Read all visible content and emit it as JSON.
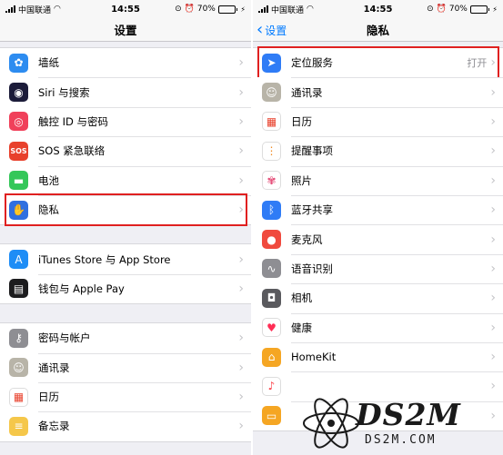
{
  "left": {
    "status": {
      "carrier": "中国联通",
      "time": "14:55",
      "battery": "70%",
      "battery_fill": 0.7
    },
    "nav_title": "设置",
    "groups": [
      [
        {
          "label": "墙纸",
          "icon": "wallpaper-icon",
          "color": "#2d8cf0"
        },
        {
          "label": "Siri 与搜索",
          "icon": "siri-icon",
          "color": "#1c1c3a"
        },
        {
          "label": "触控 ID 与密码",
          "icon": "fingerprint-icon",
          "color": "#f0405a"
        },
        {
          "label": "SOS 紧急联络",
          "icon": "sos-icon",
          "color": "#e8412c",
          "icon_text": "SOS"
        },
        {
          "label": "电池",
          "icon": "battery-icon",
          "color": "#34c759"
        },
        {
          "label": "隐私",
          "icon": "hand-icon",
          "color": "#2f6fe0",
          "highlighted": true
        }
      ],
      [
        {
          "label": "iTunes Store 与 App Store",
          "icon": "app-store-icon",
          "color": "#1e8df6"
        },
        {
          "label": "钱包与 Apple Pay",
          "icon": "wallet-icon",
          "color": "#1c1c1e"
        }
      ],
      [
        {
          "label": "密码与帐户",
          "icon": "key-icon",
          "color": "#8e8e93"
        },
        {
          "label": "通讯录",
          "icon": "contacts-icon",
          "color": "#b8b4a8"
        },
        {
          "label": "日历",
          "icon": "calendar-icon",
          "color": "#ffffff"
        },
        {
          "label": "备忘录",
          "icon": "notes-icon",
          "color": "#f5c74a"
        }
      ]
    ]
  },
  "right": {
    "status": {
      "carrier": "中国联通",
      "time": "14:55",
      "battery": "70%",
      "battery_fill": 0.7
    },
    "nav_back": "设置",
    "nav_title": "隐私",
    "groups": [
      [
        {
          "label": "定位服务",
          "icon": "location-arrow-icon",
          "color": "#2f7cf6",
          "value": "打开",
          "highlighted": true
        },
        {
          "label": "通讯录",
          "icon": "contacts-icon",
          "color": "#b8b4a8"
        },
        {
          "label": "日历",
          "icon": "calendar-icon",
          "color": "#ffffff"
        },
        {
          "label": "提醒事项",
          "icon": "reminders-icon",
          "color": "#ffffff"
        },
        {
          "label": "照片",
          "icon": "photos-icon",
          "color": "#ffffff"
        },
        {
          "label": "蓝牙共享",
          "icon": "bluetooth-icon",
          "color": "#2f7cf6"
        },
        {
          "label": "麦克风",
          "icon": "microphone-icon",
          "color": "#f04a3e"
        },
        {
          "label": "语音识别",
          "icon": "waveform-icon",
          "color": "#8e8e93"
        },
        {
          "label": "相机",
          "icon": "camera-icon",
          "color": "#5a5a5e"
        },
        {
          "label": "健康",
          "icon": "heart-icon",
          "color": "#ffffff"
        },
        {
          "label": "HomeKit",
          "icon": "home-icon",
          "color": "#f5a623"
        },
        {
          "label": "",
          "icon": "music-icon",
          "color": "#ffffff"
        },
        {
          "label": "",
          "icon": "folder-icon",
          "color": "#f5a623"
        }
      ]
    ]
  },
  "watermark": {
    "logo_text": "DS2M",
    "url_text": "DS2M.COM"
  }
}
